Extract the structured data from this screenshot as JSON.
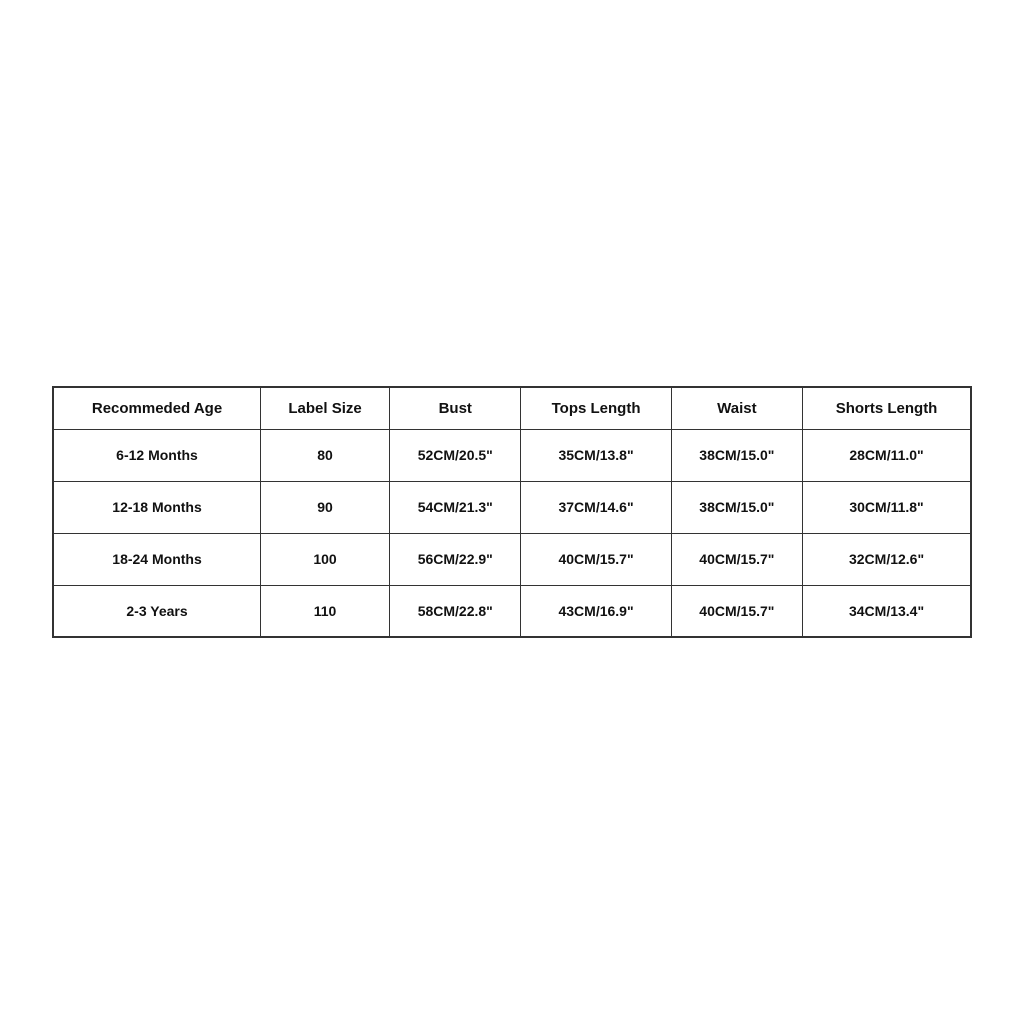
{
  "table": {
    "headers": [
      "Recommeded Age",
      "Label Size",
      "Bust",
      "Tops Length",
      "Waist",
      "Shorts Length"
    ],
    "rows": [
      {
        "age": "6-12 Months",
        "label_size": "80",
        "bust": "52CM/20.5\"",
        "tops_length": "35CM/13.8\"",
        "waist": "38CM/15.0\"",
        "shorts_length": "28CM/11.0\""
      },
      {
        "age": "12-18 Months",
        "label_size": "90",
        "bust": "54CM/21.3\"",
        "tops_length": "37CM/14.6\"",
        "waist": "38CM/15.0\"",
        "shorts_length": "30CM/11.8\""
      },
      {
        "age": "18-24 Months",
        "label_size": "100",
        "bust": "56CM/22.9\"",
        "tops_length": "40CM/15.7\"",
        "waist": "40CM/15.7\"",
        "shorts_length": "32CM/12.6\""
      },
      {
        "age": "2-3 Years",
        "label_size": "110",
        "bust": "58CM/22.8\"",
        "tops_length": "43CM/16.9\"",
        "waist": "40CM/15.7\"",
        "shorts_length": "34CM/13.4\""
      }
    ]
  }
}
